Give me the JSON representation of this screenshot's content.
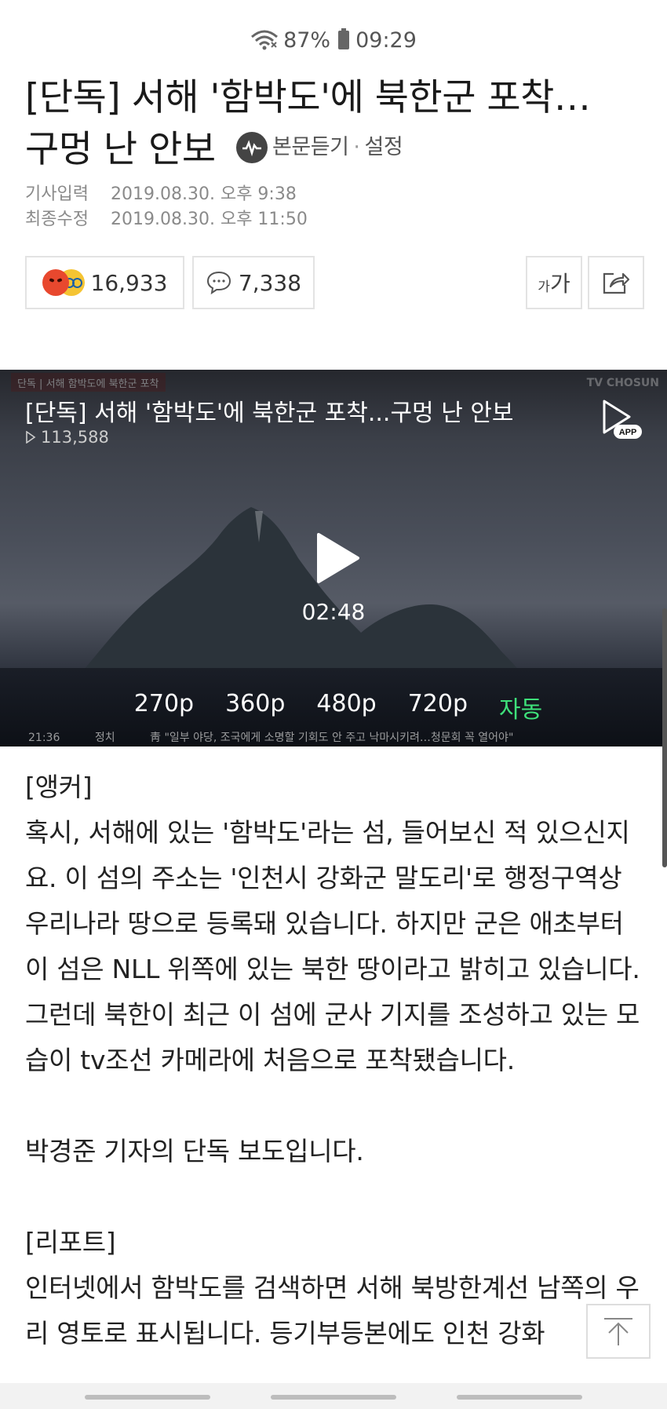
{
  "status_bar": {
    "battery": "87%",
    "time": "09:29"
  },
  "article": {
    "title_line1": "[단독] 서해 '함박도'에 북한군 포착…",
    "title_line2": "구멍 난 안보",
    "tts_label": "본문듣기",
    "settings_label": "설정",
    "published_label": "기사입력",
    "published_value": "2019.08.30. 오후 9:38",
    "modified_label": "최종수정",
    "modified_value": "2019.08.30. 오후 11:50"
  },
  "actions": {
    "reaction_count": "16,933",
    "comment_count": "7,338",
    "font_small": "가",
    "font_large": "가"
  },
  "video": {
    "overlay_tag": "단독 | 서해 함박도에 북한군 포착",
    "broadcaster": "TV CHOSUN",
    "title": "[단독] 서해 '함박도'에 북한군 포착...구멍 난 안보",
    "views": "113,588",
    "app_label": "APP",
    "duration": "02:48",
    "qualities": [
      "270p",
      "360p",
      "480p",
      "720p",
      "자동"
    ],
    "ticker_time": "21:36",
    "ticker_category": "정치",
    "ticker_text": "靑 \"일부 야당, 조국에게 소명할 기회도 안 주고 낙마시키려…청문회 꼭 열어야\""
  },
  "body": {
    "anchor_label": "[앵커]",
    "para1": "혹시, 서해에 있는 '함박도'라는 섬, 들어보신 적 있으신지요. 이 섬의 주소는 '인천시 강화군 말도리'로 행정구역상 우리나라 땅으로 등록돼 있습니다. 하지만 군은 애초부터 이 섬은 NLL 위쪽에 있는 북한 땅이라고 밝히고 있습니다. 그런데 북한이 최근 이 섬에 군사 기지를 조성하고 있는 모습이 tv조선 카메라에 처음으로 포착됐습니다.",
    "para2": "박경준 기자의 단독 보도입니다.",
    "report_label": "[리포트]",
    "para3": "인터넷에서 함박도를 검색하면 서해 북방한계선 남쪽의 우리 영토로 표시됩니다. 등기부등본에도 인천 강화"
  }
}
